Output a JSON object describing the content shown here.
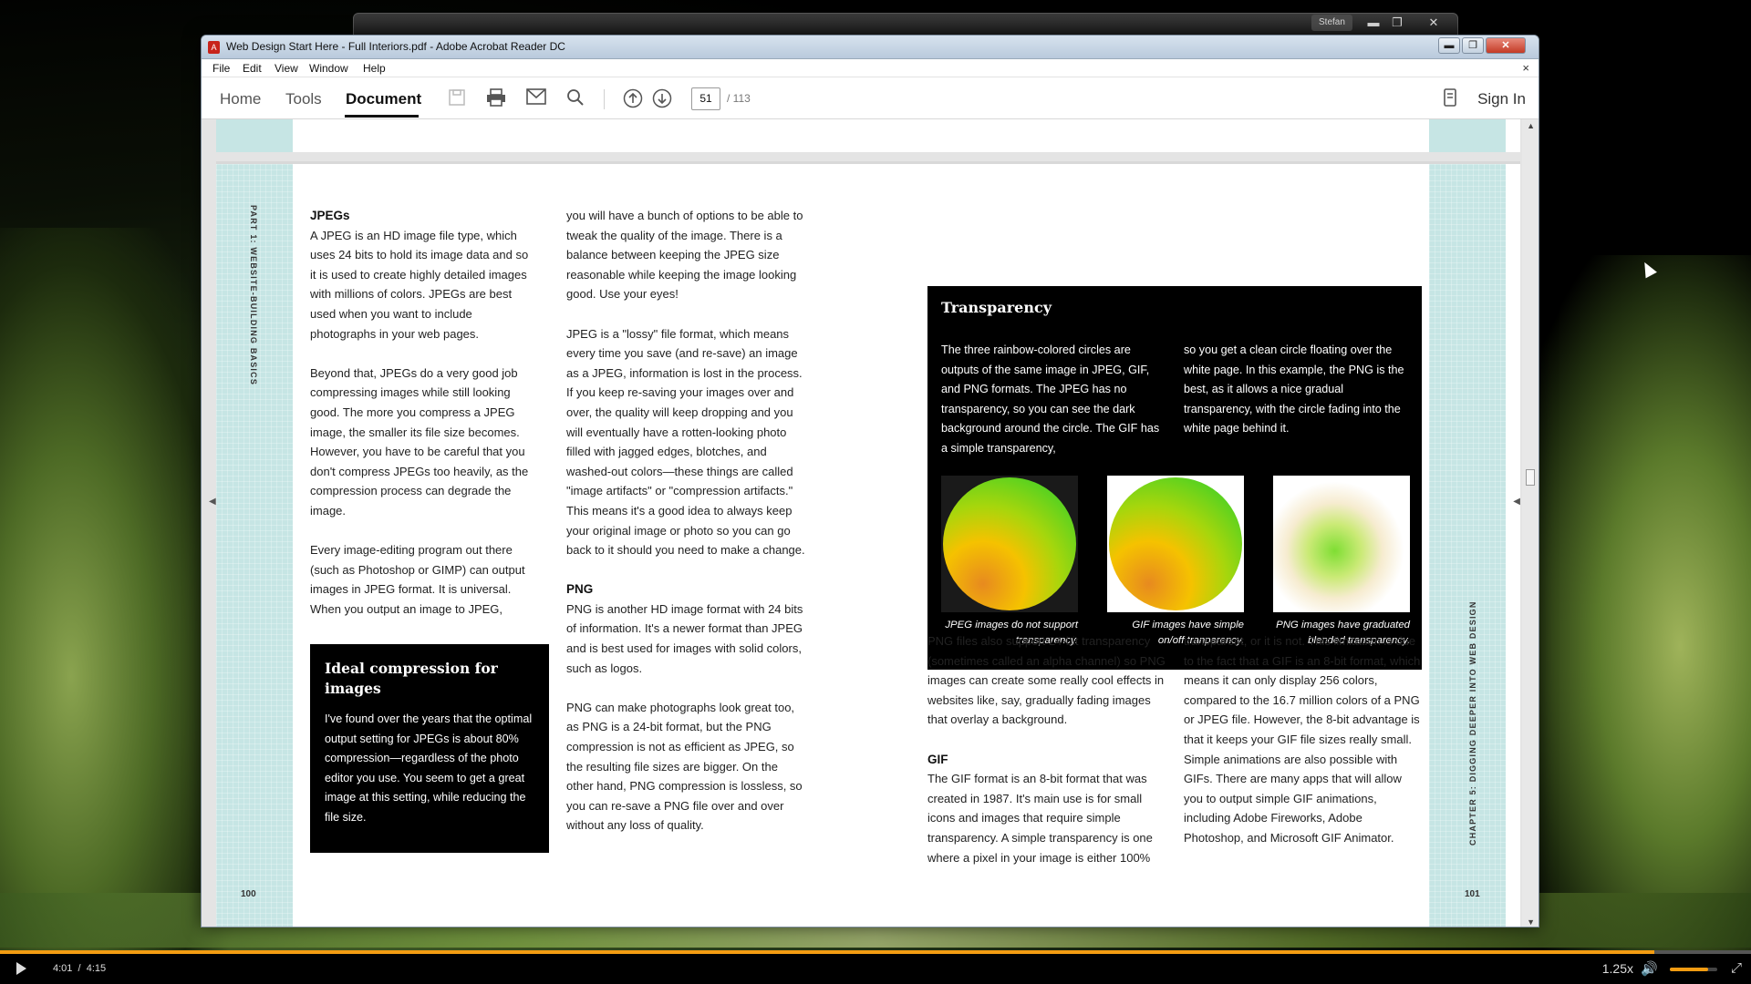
{
  "background_window": {
    "user_badge": "Stefan",
    "controls": [
      "▬",
      "❐",
      "✕"
    ]
  },
  "window": {
    "title": "Web Design Start Here - Full Interiors.pdf - Adobe Acrobat Reader DC",
    "app_icon": "acrobat-icon",
    "controls": {
      "minimize": "▬",
      "maximize": "❐",
      "close": "✕"
    }
  },
  "menubar": {
    "items": [
      "File",
      "Edit",
      "View",
      "Window",
      "Help"
    ],
    "close": "×"
  },
  "toolbar": {
    "tabs": [
      {
        "label": "Home",
        "active": false
      },
      {
        "label": "Tools",
        "active": false
      },
      {
        "label": "Document",
        "active": true
      }
    ],
    "icons": {
      "save": "💾",
      "print": "🖶",
      "email": "✉",
      "search": "⌕",
      "prev_page": "⇧",
      "next_page": "⇩"
    },
    "page_current": "51",
    "page_total": "/ 113",
    "sign_in": "Sign In"
  },
  "document": {
    "left_page": {
      "side_label": "PART 1: WEBSITE-BUILDING BASICS",
      "page_number": "100",
      "col1": {
        "heading": "JPEGs",
        "paragraphs": [
          "A JPEG is an HD image file type, which uses 24 bits to hold its image data and so it is used to create highly detailed images with millions of colors. JPEGs are best used when you want to include photographs in your web pages.",
          "Beyond that, JPEGs do a very good job compressing images while still looking good. The more you compress a JPEG image, the smaller its file size becomes. However, you have to be careful that you don't compress JPEGs too heavily, as the compression process can degrade the image.",
          "Every image-editing program out there (such as Photoshop or GIMP) can output images in JPEG format. It is universal. When you output an image to JPEG,"
        ]
      },
      "ideal_box": {
        "title": "Ideal compression for images",
        "body": "I've found over the years that the optimal output setting for JPEGs is about 80% compression—regardless of the photo editor you use. You seem to get a great image at this setting, while reducing the file size."
      },
      "col2": {
        "paragraphs": [
          "you will have a bunch of options to be able to tweak the quality of the image. There is a balance between keeping the JPEG size reasonable while keeping the image looking good. Use your eyes!",
          "JPEG is a \"lossy\" file format, which means every time you save (and re-save) an image as a JPEG, information is lost in the process. If you keep re-saving your images over and over, the quality will keep dropping and you will eventually have a rotten-looking photo filled with jagged edges, blotches, and washed-out colors—these things are called \"image artifacts\" or \"compression artifacts.\" This means it's a good idea to always keep your original image or photo so you can go back to it should you need to make a change."
        ],
        "png_heading": "PNG",
        "png_paragraphs": [
          "PNG is another HD image format with 24 bits of information. It's a newer format than JPEG and is best used for images with solid colors, such as logos.",
          "PNG can make photographs look great too, as PNG is a 24-bit format, but the PNG compression is not as efficient as JPEG, so the resulting file sizes are bigger. On the other hand, PNG compression is lossless, so you can re-save a PNG file over and over without any loss of quality."
        ]
      }
    },
    "right_page": {
      "side_label": "CHAPTER 5: DIGGING DEEPER INTO WEB DESIGN",
      "page_number": "101",
      "transparency_box": {
        "title": "Transparency",
        "col1": "The three rainbow-colored circles are outputs of the same image in JPEG, GIF, and PNG formats. The JPEG has no transparency, so you can see the dark background around the circle. The GIF has a simple transparency,",
        "col2": "so you get a clean circle floating over the white page. In this example, the PNG is the best, as it allows a nice gradual transparency, with the circle fading into the white page behind it.",
        "captions": [
          "JPEG images do not support transparency.",
          "GIF images have simple on/off tranparency.",
          "PNG images have graduated blended transparency."
        ]
      },
      "col1": {
        "paragraph": "PNG files also support 24-bit transparency (sometimes called an alpha channel) so PNG images can create some really cool effects in websites like, say, gradually fading images that overlay a background.",
        "gif_heading": "GIF",
        "gif_paragraph": "The GIF format is an 8-bit format that was created in 1987. It's main use is for small icons and images that require simple transparency. A simple transparency is one where a pixel in your image is either 100%"
      },
      "col2": {
        "paragraph": "transparent, or it is not. This limitation is due to the fact that a GIF is an 8-bit format, which means it can only display 256 colors, compared to the 16.7 million colors of a PNG or JPEG file. However, the 8-bit advantage is that it keeps your GIF file sizes really small. Simple animations are also possible with GIFs. There are many apps that will allow you to output simple GIF animations, including Adobe Fireworks, Adobe Photoshop, and Microsoft GIF Animator."
      }
    }
  },
  "video_player": {
    "time_current": "4:01",
    "time_separator": "/",
    "time_total": "4:15",
    "progress_fraction": 0.945,
    "speed": "1.25x",
    "volume_fraction": 0.8,
    "colors": {
      "accent": "#f39c12"
    }
  }
}
